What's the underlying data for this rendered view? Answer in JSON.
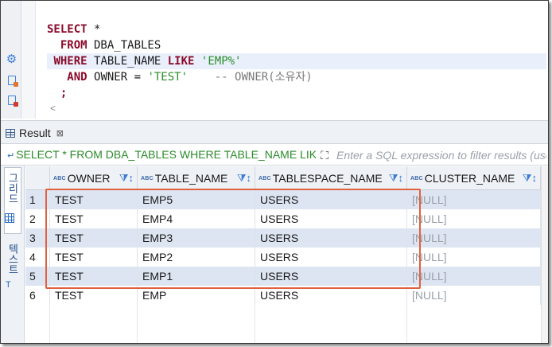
{
  "editor": {
    "lines": [
      {
        "parts": [
          {
            "t": "kw",
            "v": "SELECT"
          },
          {
            "t": "plain",
            "v": " *"
          }
        ]
      },
      {
        "parts": [
          {
            "t": "plain",
            "v": "  "
          },
          {
            "t": "kw",
            "v": "FROM"
          },
          {
            "t": "plain",
            "v": " DBA_TABLES"
          }
        ]
      },
      {
        "parts": [
          {
            "t": "plain",
            "v": " "
          },
          {
            "t": "kw",
            "v": "WHERE"
          },
          {
            "t": "plain",
            "v": " TABLE_NAME "
          },
          {
            "t": "kw",
            "v": "LIKE"
          },
          {
            "t": "plain",
            "v": " "
          },
          {
            "t": "str",
            "v": "'EMP%'"
          }
        ],
        "highlight": true
      },
      {
        "parts": [
          {
            "t": "plain",
            "v": "   "
          },
          {
            "t": "kw",
            "v": "AND"
          },
          {
            "t": "plain",
            "v": " OWNER = "
          },
          {
            "t": "str",
            "v": "'TEST'"
          },
          {
            "t": "plain",
            "v": "    "
          },
          {
            "t": "cmt",
            "v": "-- OWNER(소유자)"
          }
        ]
      },
      {
        "parts": [
          {
            "t": "plain",
            "v": "  "
          },
          {
            "t": "kw",
            "v": ";"
          }
        ]
      }
    ],
    "scroll_arrow": "<",
    "gutter_icons": [
      "gear-icon",
      "document-run-icon",
      "document-stop-icon"
    ]
  },
  "results_tab": {
    "label": "Result",
    "close": "⊠"
  },
  "filter": {
    "query_text": "SELECT * FROM DBA_TABLES WHERE TABLE_NAME LIKE 'EMP%' AND OWNER = 'TEST'",
    "placeholder": "Enter a SQL expression to filter results (use Ctrl+Space)"
  },
  "side_tabs": {
    "grid": "그리드",
    "text": "텍스트"
  },
  "table": {
    "columns": [
      {
        "type": "ABC",
        "name": "OWNER"
      },
      {
        "type": "ABC",
        "name": "TABLE_NAME"
      },
      {
        "type": "ABC",
        "name": "TABLESPACE_NAME"
      },
      {
        "type": "ABC",
        "name": "CLUSTER_NAME"
      }
    ],
    "rows": [
      {
        "n": "1",
        "owner": "TEST",
        "table_name": "EMP5",
        "tablespace": "USERS",
        "cluster": "[NULL]"
      },
      {
        "n": "2",
        "owner": "TEST",
        "table_name": "EMP4",
        "tablespace": "USERS",
        "cluster": "[NULL]"
      },
      {
        "n": "3",
        "owner": "TEST",
        "table_name": "EMP3",
        "tablespace": "USERS",
        "cluster": "[NULL]"
      },
      {
        "n": "4",
        "owner": "TEST",
        "table_name": "EMP2",
        "tablespace": "USERS",
        "cluster": "[NULL]"
      },
      {
        "n": "5",
        "owner": "TEST",
        "table_name": "EMP1",
        "tablespace": "USERS",
        "cluster": "[NULL]"
      },
      {
        "n": "6",
        "owner": "TEST",
        "table_name": "EMP",
        "tablespace": "USERS",
        "cluster": "[NULL]"
      }
    ],
    "highlight_color": "#e0613f"
  }
}
